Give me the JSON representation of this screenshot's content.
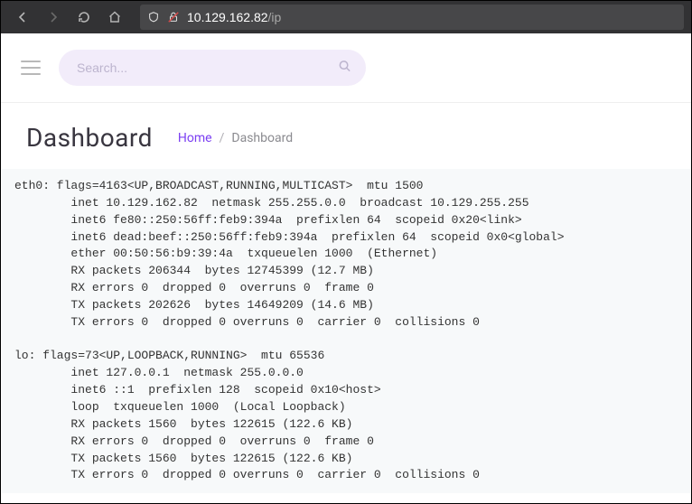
{
  "browser": {
    "url_host": "10.129.162.82",
    "url_path": "/ip"
  },
  "header": {
    "search_placeholder": "Search..."
  },
  "title": "Dashboard",
  "breadcrumb": {
    "home": "Home",
    "sep": "/",
    "current": "Dashboard"
  },
  "output": "eth0: flags=4163<UP,BROADCAST,RUNNING,MULTICAST>  mtu 1500\n        inet 10.129.162.82  netmask 255.255.0.0  broadcast 10.129.255.255\n        inet6 fe80::250:56ff:feb9:394a  prefixlen 64  scopeid 0x20<link>\n        inet6 dead:beef::250:56ff:feb9:394a  prefixlen 64  scopeid 0x0<global>\n        ether 00:50:56:b9:39:4a  txqueuelen 1000  (Ethernet)\n        RX packets 206344  bytes 12745399 (12.7 MB)\n        RX errors 0  dropped 0  overruns 0  frame 0\n        TX packets 202626  bytes 14649209 (14.6 MB)\n        TX errors 0  dropped 0 overruns 0  carrier 0  collisions 0\n\nlo: flags=73<UP,LOOPBACK,RUNNING>  mtu 65536\n        inet 127.0.0.1  netmask 255.0.0.0\n        inet6 ::1  prefixlen 128  scopeid 0x10<host>\n        loop  txqueuelen 1000  (Local Loopback)\n        RX packets 1560  bytes 122615 (122.6 KB)\n        RX errors 0  dropped 0  overruns 0  frame 0\n        TX packets 1560  bytes 122615 (122.6 KB)\n        TX errors 0  dropped 0 overruns 0  carrier 0  collisions 0\n"
}
